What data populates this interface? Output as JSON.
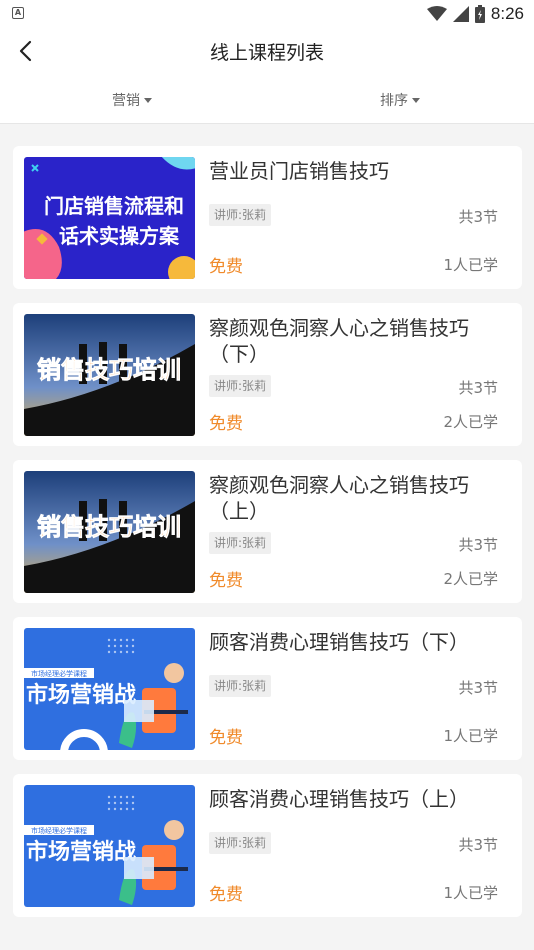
{
  "status_bar": {
    "time": "8:26",
    "app_indicator": "A"
  },
  "header": {
    "title": "线上课程列表"
  },
  "filters": {
    "marketing": "营销",
    "sort": "排序"
  },
  "colors": {
    "accent": "#f08a2a",
    "background": "#f4f4f4",
    "card": "#ffffff"
  },
  "courses": [
    {
      "title_line1": "营业员门店销售技巧",
      "title_line2": "",
      "teacher": "讲师:张莉",
      "lessons": "共3节",
      "price": "免费",
      "learned": "1人已学",
      "thumb": {
        "line1": "门店销售流程和",
        "line2": "话术实操方案"
      }
    },
    {
      "title_line1": "察颜观色洞察人心之销售技巧",
      "title_line2": "（下）",
      "teacher": "讲师:张莉",
      "lessons": "共3节",
      "price": "免费",
      "learned": "2人已学",
      "thumb": {
        "text": "销售技巧培训"
      }
    },
    {
      "title_line1": "察颜观色洞察人心之销售技巧",
      "title_line2": "（上）",
      "teacher": "讲师:张莉",
      "lessons": "共3节",
      "price": "免费",
      "learned": "2人已学",
      "thumb": {
        "text": "销售技巧培训"
      }
    },
    {
      "title_line1": "顾客消费心理销售技巧（下）",
      "title_line2": "",
      "teacher": "讲师:张莉",
      "lessons": "共3节",
      "price": "免费",
      "learned": "1人已学",
      "thumb": {
        "small": "市场经理必学课程",
        "big": "市场营销战"
      }
    },
    {
      "title_line1": "顾客消费心理销售技巧（上）",
      "title_line2": "",
      "teacher": "讲师:张莉",
      "lessons": "共3节",
      "price": "免费",
      "learned": "1人已学",
      "thumb": {
        "small": "市场经理必学课程",
        "big": "市场营销战"
      }
    }
  ]
}
